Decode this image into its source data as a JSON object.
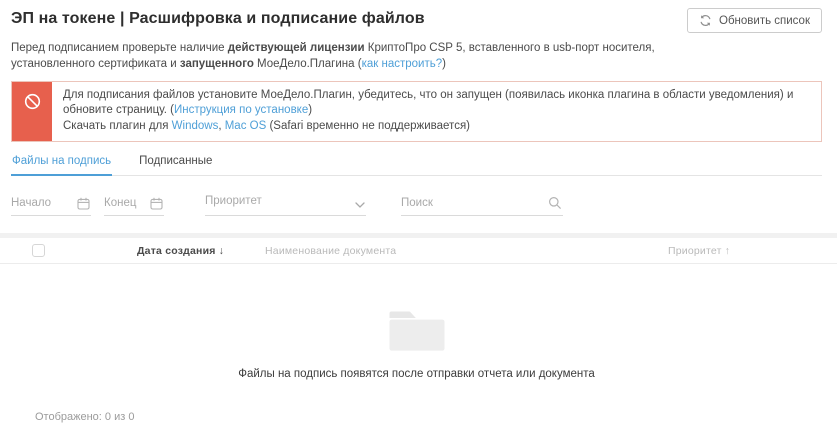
{
  "colors": {
    "accent_red": "#e7604d",
    "alert_border": "#ecc5bb",
    "link_blue": "#4e9fd7",
    "tab_active_blue": "#4e9fd7",
    "placeholder_gray": "#a9a9a9"
  },
  "icons": {
    "refresh": "refresh-icon",
    "no_entry": "no-entry-icon",
    "calendar": "calendar-icon",
    "chevron": "chevron-down-icon",
    "search": "search-icon",
    "folder": "folder-icon"
  },
  "header": {
    "title": "ЭП на токене | Расшифровка и подписание файлов",
    "refresh_button": "Обновить список"
  },
  "intro": {
    "segments": [
      {
        "t": "Перед подписанием проверьте наличие "
      },
      {
        "t": "действующей лицензии",
        "s": "bold"
      },
      {
        "t": " КриптоПро CSP 5, вставленного в usb-порт носителя, установленного сертификата и "
      },
      {
        "t": "запущенного",
        "s": "bold"
      },
      {
        "t": " МоеДело.Плагина ("
      },
      {
        "t": "как настроить?",
        "s": "link"
      },
      {
        "t": ")"
      }
    ]
  },
  "alert": {
    "paragraphs": [
      [
        {
          "t": "Для подписания файлов установите МоеДело.Плагин, убедитесь, что он запущен (появилась иконка плагина в области уведомления) и обновите страницу. ("
        },
        {
          "t": "Инструкция по установке",
          "s": "link"
        },
        {
          "t": ")"
        }
      ],
      [
        {
          "t": "Скачать плагин для "
        },
        {
          "t": "Windows",
          "s": "link"
        },
        {
          "t": ", "
        },
        {
          "t": "Mac OS",
          "s": "link"
        },
        {
          "t": " (Safari временно не поддерживается)"
        }
      ]
    ]
  },
  "tabs": [
    {
      "label": "Файлы на подпись",
      "active": true
    },
    {
      "label": "Подписанные",
      "active": false
    }
  ],
  "filters": {
    "date_start_placeholder": "Начало",
    "date_end_placeholder": "Конец",
    "date_start_value": "",
    "date_end_value": "",
    "priority_placeholder": "Приоритет",
    "priority_value": "",
    "search_placeholder": "Поиск",
    "search_value": ""
  },
  "table": {
    "columns": [
      {
        "label": "Дата создания",
        "sort": "↓"
      },
      {
        "label": "Наименование документа",
        "sort": ""
      },
      {
        "label": "Приоритет",
        "sort": "↑"
      }
    ],
    "rows": []
  },
  "empty_state": {
    "message": "Файлы на подпись появятся после отправки отчета или документа"
  },
  "footer": {
    "shown_label": "Отображено: 0 из 0"
  }
}
